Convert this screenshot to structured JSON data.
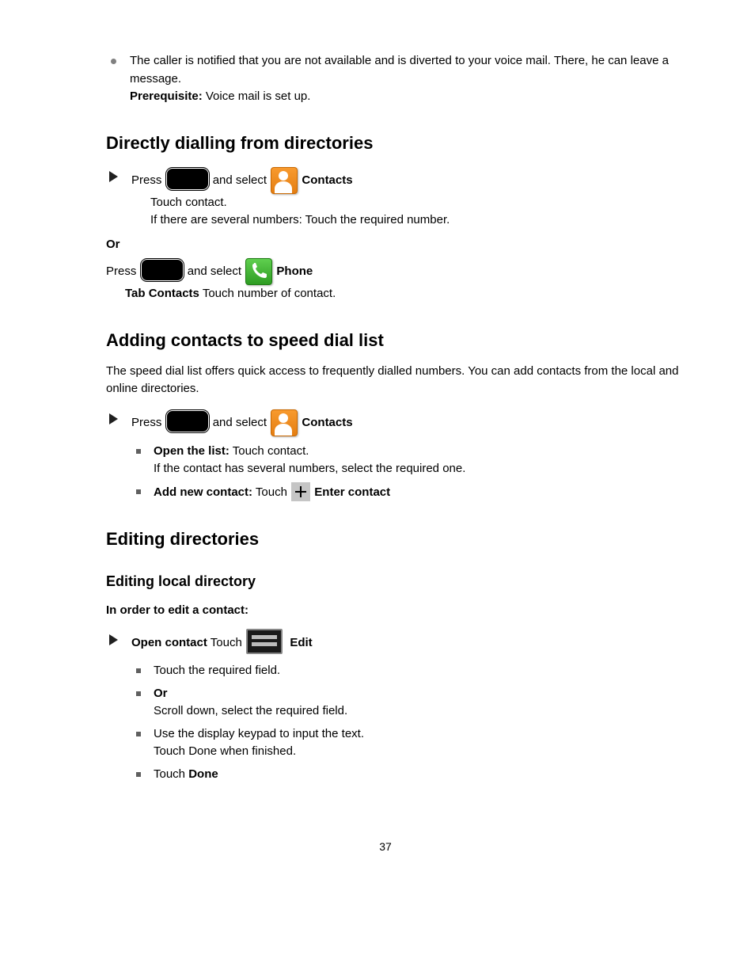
{
  "bullet_text": "The caller is notified that you are not available and is diverted to your voice mail. There, he can leave a message.",
  "prereq_bold": "Prerequisite:",
  "prereq_text": " Voice mail is set up.",
  "h2_direct": "Directly dialling from directories",
  "step_press": "Press ",
  "step_and_select": "and select ",
  "step_contacts": "Contacts ",
  "step_touch_contact": "Touch contact.",
  "step_several_numbers": "If there are several numbers:",
  "step_touch_number": " Touch the required number.",
  "step_or_bold": "Or",
  "step_phone": " Phone ",
  "step_tab_contacts": " Tab Contacts",
  "step_touch_number2": " Touch number of contact.",
  "h2_add": "Adding contacts to speed dial list",
  "add_intro": "The speed dial list offers quick access to frequently dialled numbers. You can add contacts from the local and online directories.",
  "add_open_list": "Open the list:",
  "add_several": " If the contact has several numbers, select the required one.",
  "add_new_contact": "Add new contact:",
  "add_touch": " Touch ",
  "add_enter_contact": "Enter contact",
  "h2_edit": "Editing directories",
  "edit_intro": "In order to edit a contact:",
  "edit_open": "Open contact",
  "edit_touch": " Touch ",
  "edit_edit": "Edit",
  "edit_touch_field": "Touch the required field.",
  "edit_or_bold": "Or",
  "edit_scroll": "Scroll down, select the required field.",
  "edit_use_keypad": "Use the display keypad to input the text.",
  "edit_touch_done": "Touch Done when finished.",
  "edit_done": "Done",
  "page_number": "37"
}
